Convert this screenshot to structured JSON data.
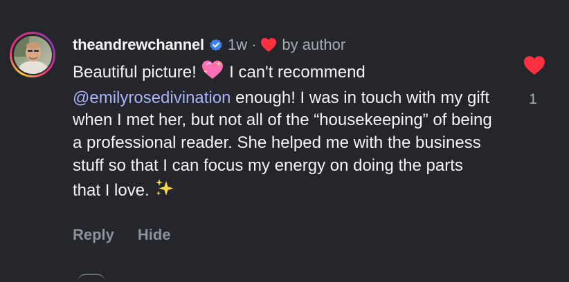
{
  "comment": {
    "username": "theandrewchannel",
    "timestamp": "1w",
    "separator": "·",
    "by_author_label": "by author",
    "text_part1": "Beautiful picture! ",
    "emoji1": "sparkling-heart",
    "text_part2": " I can't recommend ",
    "mention": "@emilyrosedivination",
    "text_part3": " enough! I was in touch with my gift when I met her, but not all of the “housekeeping” of being a professional reader. She helped me with the business stuff so that I can focus my energy on doing the parts that I love. ",
    "emoji2": "sparkles",
    "like_count": "1"
  },
  "actions": {
    "reply_label": "Reply",
    "hide_label": "Hide"
  },
  "colors": {
    "background": "#24262c",
    "heart": "#ff3040",
    "verified": "#3b82f6",
    "mention": "#a9b4f5",
    "muted": "#a8abb3"
  },
  "icons": {
    "verified": "verified-badge-icon",
    "small_heart": "heart-icon",
    "like": "like-heart-icon"
  }
}
